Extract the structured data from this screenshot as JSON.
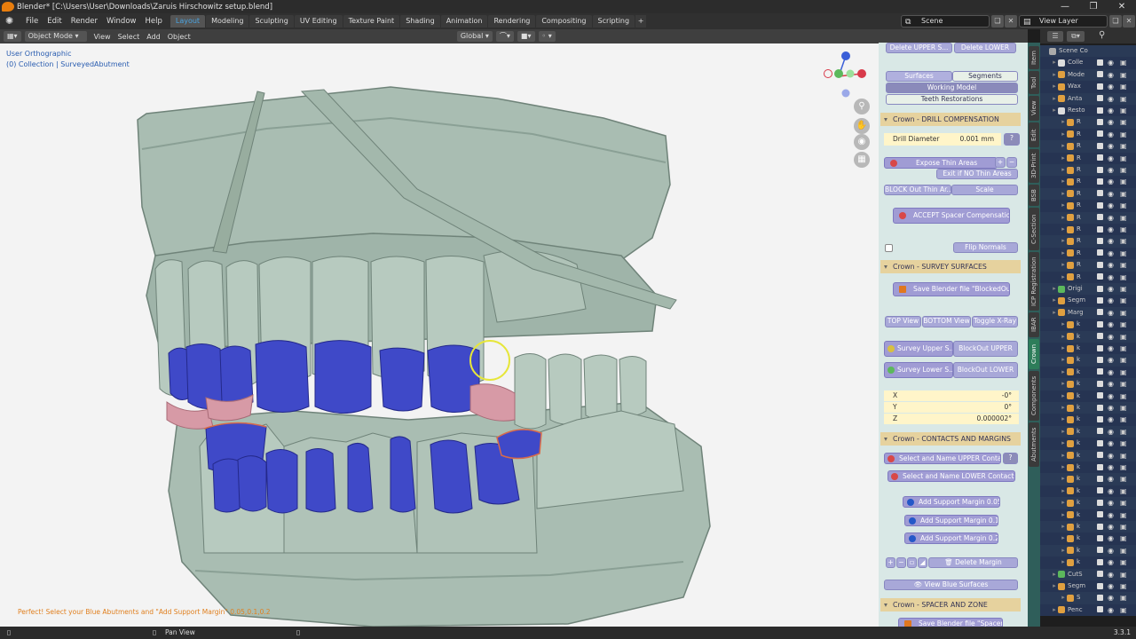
{
  "window": {
    "title": "Blender* [C:\\Users\\User\\Downloads\\Zaruis Hirschowitz setup.blend]"
  },
  "menus": [
    "File",
    "Edit",
    "Render",
    "Window",
    "Help"
  ],
  "workspaces": [
    "Layout",
    "Modeling",
    "Sculpting",
    "UV Editing",
    "Texture Paint",
    "Shading",
    "Animation",
    "Rendering",
    "Compositing",
    "Scripting"
  ],
  "scene": {
    "name": "Scene",
    "view_layer": "View Layer"
  },
  "viewport": {
    "mode": "Object Mode",
    "menus": [
      "View",
      "Select",
      "Add",
      "Object"
    ],
    "orientation": "Global",
    "view_label": "User Orthographic",
    "collection_label": "(0) Collection | SurveyedAbutment",
    "hint": "Perfect! Select your Blue Abutments and \"Add Support Margin\" 0.05,0.1,0.2"
  },
  "sidebar": {
    "top_buttons": [
      "Delete UPPER S...",
      "Delete LOWER"
    ],
    "toggle_row": [
      "Surfaces",
      "Segments"
    ],
    "working_model": "Working Model",
    "teeth_restorations": "Teeth Restorations",
    "drill": {
      "header": "Crown - DRILL COMPENSATION",
      "label": "Drill Diameter",
      "value": "0.001 mm",
      "expose": "Expose Thin Areas",
      "exit": "Exit if NO Thin Areas",
      "blockout": "BLOCK Out Thin Ar...",
      "scale": "Scale",
      "accept": "ACCEPT Spacer Compensation",
      "flip": "Flip Normals"
    },
    "survey": {
      "header": "Crown - SURVEY SURFACES",
      "save": "Save Blender file \"BlockedOut\"",
      "views": [
        "TOP View",
        "BOTTOM View",
        "Toggle X-Ray"
      ],
      "survey_upper": "Survey Upper S...",
      "blockout_upper": "BlockOut UPPER",
      "survey_lower": "Survey Lower S...",
      "blockout_lower": "BlockOut LOWER",
      "x_label": "X",
      "x_value": "-0°",
      "y_label": "Y",
      "y_value": "0°",
      "z_label": "Z",
      "z_value": "0.000002°"
    },
    "contacts": {
      "header": "Crown - CONTACTS AND MARGINS",
      "upper": "Select and Name UPPER Conta...",
      "lower": "Select and Name LOWER Contacts",
      "m005": "Add Support Margin 0.05",
      "m01": "Add Support Margin 0.1",
      "m02": "Add Support Margin 0.2",
      "delete": "Delete Margin",
      "view_blue": "View Blue Surfaces"
    },
    "spacer": {
      "header": "Crown - SPACER AND ZONE",
      "save": "Save Blender file \"Spacer\""
    },
    "help_glyph": "?"
  },
  "side_tabs": [
    "Item",
    "Tool",
    "View",
    "Edit",
    "3D-Print",
    "BSB",
    "C-Section",
    "ICP Registration",
    "IBAR",
    "Crown",
    "Components",
    "Abutments"
  ],
  "outliner": {
    "rows": [
      "Scene Co",
      "Colle",
      "Mode",
      "Wax",
      "Anta",
      "Resto",
      "R",
      "R",
      "R",
      "R",
      "R",
      "R",
      "R",
      "R",
      "R",
      "R",
      "R",
      "R",
      "R",
      "R",
      "Origi",
      "Segm",
      "Marg",
      "k",
      "k",
      "k",
      "k",
      "k",
      "k",
      "k",
      "k",
      "k",
      "k",
      "k",
      "k",
      "k",
      "k",
      "k",
      "k",
      "k",
      "k",
      "k",
      "k",
      "k",
      "CutS",
      "Segm",
      "S",
      "Penc"
    ]
  },
  "statusbar": {
    "pan": "Pan View",
    "version": "3.3.1"
  },
  "colors": {
    "accent_blue": "#4aa3e0",
    "sidebar_bg": "#d9e8e6",
    "button_purple": "#a09cd4",
    "panel_header": "#e6d29e",
    "field_yellow": "#fff5c9",
    "model_gray": "#a9bdb2",
    "abutment_blue": "#3f49c8",
    "margin_pink": "#d79aa6"
  }
}
